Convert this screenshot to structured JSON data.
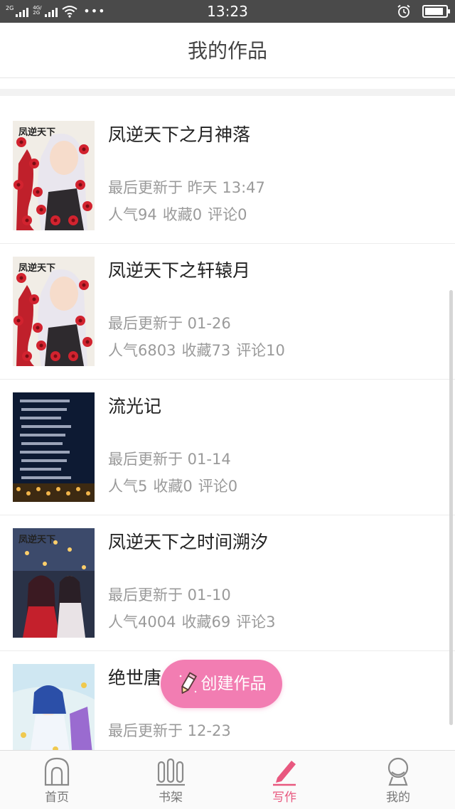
{
  "status_bar": {
    "time": "13:23",
    "sim1": "2G",
    "sim2": "4G/2G",
    "battery_level": 0.9
  },
  "header": {
    "title": "我的作品"
  },
  "works": [
    {
      "title": "凤逆天下之月神落",
      "updated": "最后更新于 昨天 13:47",
      "popularity": "人气94",
      "favorites": "收藏0",
      "comments": "评论0",
      "cover_text": "凤逆天下",
      "cover_style": "red-flowers"
    },
    {
      "title": "凤逆天下之轩辕月",
      "updated": "最后更新于 01-26",
      "popularity": "人气6803",
      "favorites": "收藏73",
      "comments": "评论10",
      "cover_text": "凤逆天下",
      "cover_style": "red-flowers"
    },
    {
      "title": "流光记",
      "updated": "最后更新于 01-14",
      "popularity": "人气5",
      "favorites": "收藏0",
      "comments": "评论0",
      "cover_text": "",
      "cover_style": "night-poem"
    },
    {
      "title": "凤逆天下之时间溯汐",
      "updated": "最后更新于 01-10",
      "popularity": "人气4004",
      "favorites": "收藏69",
      "comments": "评论3",
      "cover_text": "凤逆天下",
      "cover_style": "lanterns"
    },
    {
      "title": "绝世唐",
      "updated": "最后更新于 12-23",
      "popularity": "",
      "favorites": "",
      "comments": "",
      "cover_text": "",
      "cover_style": "anime-blue"
    }
  ],
  "fab": {
    "label": "创建作品",
    "icon": "pencil-icon"
  },
  "tabs": [
    {
      "label": "首页",
      "icon": "home-icon",
      "active": false
    },
    {
      "label": "书架",
      "icon": "bookshelf-icon",
      "active": false
    },
    {
      "label": "写作",
      "icon": "pen-icon",
      "active": true
    },
    {
      "label": "我的",
      "icon": "user-icon",
      "active": false
    }
  ],
  "colors": {
    "accent": "#e8587f",
    "fab": "#f27db2",
    "muted_text": "#9a9a9a"
  }
}
